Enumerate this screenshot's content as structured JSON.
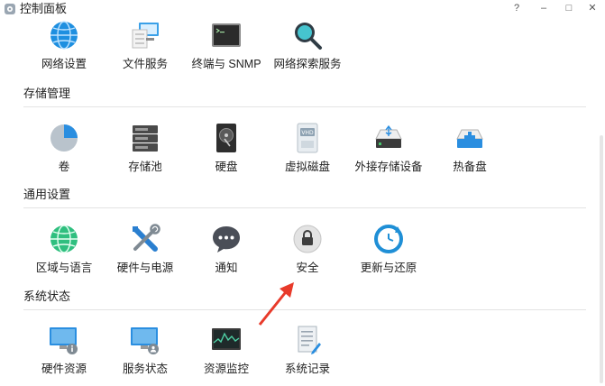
{
  "window": {
    "title": "控制面板",
    "controls": [
      "?",
      "–",
      "□",
      "✕"
    ]
  },
  "sections": [
    {
      "title": "",
      "items": [
        {
          "label": "网络设置",
          "icon": "globe-network-icon"
        },
        {
          "label": "文件服务",
          "icon": "file-services-icon"
        },
        {
          "label": "终端与 SNMP",
          "icon": "terminal-icon"
        },
        {
          "label": "网络探索服务",
          "icon": "discovery-search-icon"
        }
      ]
    },
    {
      "title": "存储管理",
      "items": [
        {
          "label": "卷",
          "icon": "volume-pie-icon"
        },
        {
          "label": "存储池",
          "icon": "storage-pool-icon"
        },
        {
          "label": "硬盘",
          "icon": "hard-disk-icon"
        },
        {
          "label": "虚拟磁盘",
          "icon": "vhd-icon"
        },
        {
          "label": "外接存储设备",
          "icon": "usb-drive-icon"
        },
        {
          "label": "热备盘",
          "icon": "hot-spare-icon"
        }
      ]
    },
    {
      "title": "通用设置",
      "items": [
        {
          "label": "区域与语言",
          "icon": "region-globe-icon"
        },
        {
          "label": "硬件与电源",
          "icon": "tools-icon"
        },
        {
          "label": "通知",
          "icon": "chat-bubble-icon"
        },
        {
          "label": "安全",
          "icon": "lock-icon"
        },
        {
          "label": "更新与还原",
          "icon": "update-restore-icon"
        }
      ]
    },
    {
      "title": "系统状态",
      "items": [
        {
          "label": "硬件资源",
          "icon": "hardware-monitor-icon"
        },
        {
          "label": "服务状态",
          "icon": "service-status-icon"
        },
        {
          "label": "资源监控",
          "icon": "resource-monitor-icon"
        },
        {
          "label": "系统记录",
          "icon": "system-log-icon"
        }
      ]
    }
  ],
  "colors": {
    "accent_blue": "#1f8fd6",
    "annotation_red": "#e83a2a",
    "divider": "#e3e3e3"
  }
}
